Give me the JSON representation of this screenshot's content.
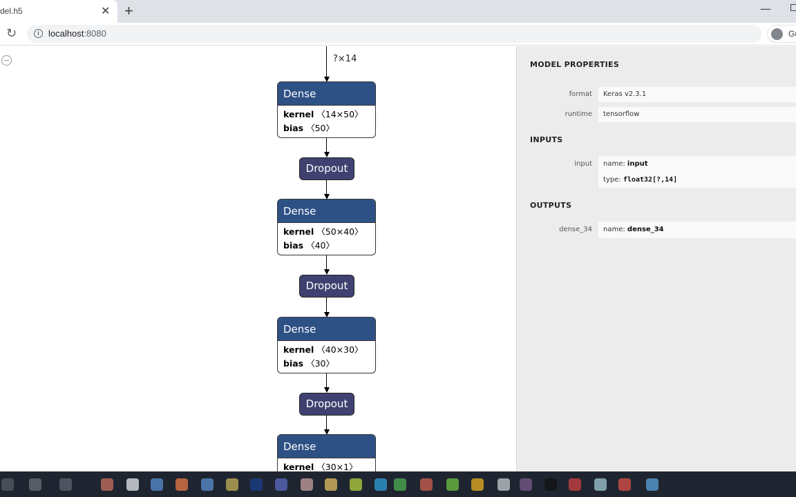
{
  "browser": {
    "tab_title": "del.h5",
    "tab_close": "✕",
    "new_tab": "+",
    "url_host": "localhost",
    "url_port": ":8080",
    "profile_label": "Gu",
    "minimize": "—"
  },
  "graph": {
    "input_edge_label": "?×14",
    "nodes": [
      {
        "type": "Dense",
        "kernel_label": "kernel",
        "kernel": "〈14×50〉",
        "bias_label": "bias",
        "bias": "〈50〉"
      },
      {
        "type": "Dropout"
      },
      {
        "type": "Dense",
        "kernel_label": "kernel",
        "kernel": "〈50×40〉",
        "bias_label": "bias",
        "bias": "〈40〉"
      },
      {
        "type": "Dropout"
      },
      {
        "type": "Dense",
        "kernel_label": "kernel",
        "kernel": "〈40×30〉",
        "bias_label": "bias",
        "bias": "〈30〉"
      },
      {
        "type": "Dropout"
      },
      {
        "type": "Dense",
        "kernel_label": "kernel",
        "kernel": "〈30×1〉"
      }
    ]
  },
  "sidebar": {
    "model_properties_title": "MODEL PROPERTIES",
    "properties": [
      {
        "name": "format",
        "value": "Keras v2.3.1"
      },
      {
        "name": "runtime",
        "value": "tensorflow"
      }
    ],
    "inputs_title": "INPUTS",
    "input": {
      "name": "input",
      "name_prefix": "name: ",
      "name_value": "input",
      "type_prefix": "type: ",
      "type_value": "float32[?,14]"
    },
    "outputs_title": "OUTPUTS",
    "output": {
      "name": "dense_34",
      "name_prefix": "name: ",
      "name_value": "dense_34"
    }
  },
  "taskbar": {
    "icon_colors": [
      "#555c66",
      "#6a7078",
      "#5d6470",
      "#c9705f",
      "#e8eaee",
      "#5a8fd0",
      "#e87a45",
      "#5a8fd0",
      "#c8b056",
      "#1a3f8a",
      "#5c6ac0",
      "#c9a0a0",
      "#e0c060",
      "#b8d040",
      "#30a0d8",
      "#4caf50",
      "#d06050",
      "#6fc040",
      "#e8b020",
      "#c8ccd0",
      "#7a5a8a",
      "#111111",
      "#d04040",
      "#a0c8d0",
      "#e05048",
      "#5aa0d8"
    ]
  }
}
